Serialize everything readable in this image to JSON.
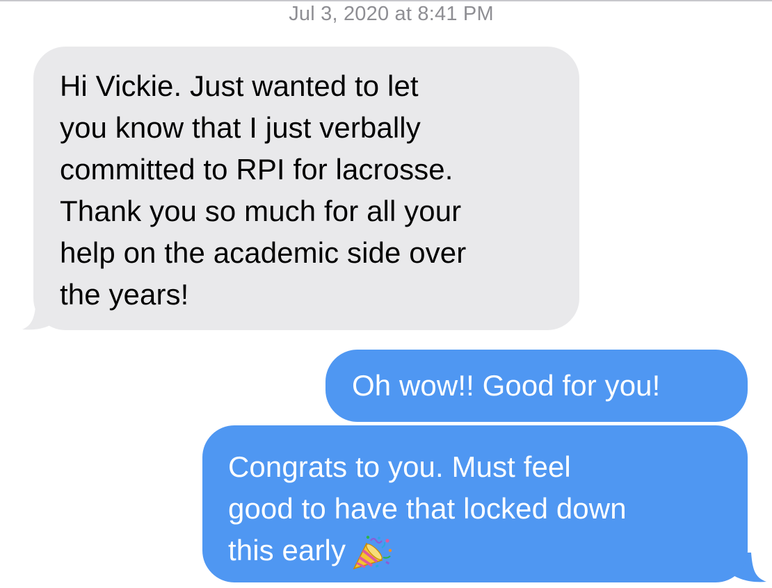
{
  "conversation": {
    "timestamp_date": "Jul 3, 2020",
    "timestamp_sep": "at",
    "timestamp_time": "8:41 PM",
    "colors": {
      "received_bubble": "#e9e9eb",
      "sent_bubble": "#4f97f2",
      "timestamp_text": "#8e8e93"
    },
    "messages": [
      {
        "direction": "received",
        "lines": [
          "Hi Vickie. Just wanted to let",
          "you know that I just verbally",
          "committed to RPI for lacrosse.",
          "Thank you so much for all your",
          "help on the academic side over",
          "the years!"
        ]
      },
      {
        "direction": "sent",
        "lines": [
          "Oh wow!! Good for you!"
        ]
      },
      {
        "direction": "sent",
        "lines": [
          "Congrats to you. Must feel",
          "good to have that locked down",
          "this early"
        ],
        "emoji": "party-popper-icon"
      }
    ]
  }
}
